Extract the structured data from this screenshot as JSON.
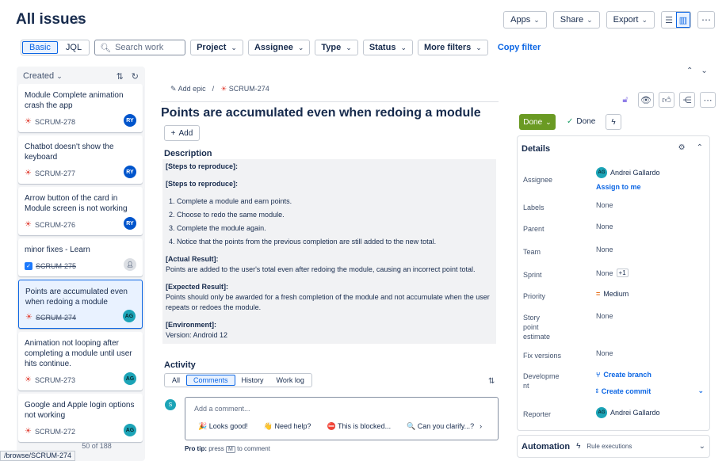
{
  "header": {
    "title": "All issues",
    "apps": "Apps",
    "share": "Share",
    "export": "Export"
  },
  "filters": {
    "basic": "Basic",
    "jql": "JQL",
    "search_placeholder": "Search work",
    "project": "Project",
    "assignee": "Assignee",
    "type": "Type",
    "status": "Status",
    "more": "More filters",
    "copy": "Copy filter"
  },
  "list": {
    "sort_label": "Created",
    "footer": "50 of 188",
    "url_tip": "/browse/SCRUM-274",
    "cards": [
      {
        "title": "Module Complete animation crash the app",
        "key": "SCRUM-278",
        "avatar": "RY"
      },
      {
        "title": "Chatbot doesn't show the keyboard",
        "key": "SCRUM-277",
        "avatar": "RY"
      },
      {
        "title": "Arrow button of the card in Module screen is not working",
        "key": "SCRUM-276",
        "avatar": "RY"
      },
      {
        "title": "minor fixes - Learn",
        "key": "SCRUM-275",
        "avatar": ""
      },
      {
        "title": "Points are accumulated even when redoing a module",
        "key": "SCRUM-274",
        "avatar": "AG"
      },
      {
        "title": "Animation not looping after completing a module until user hits continue.",
        "key": "SCRUM-273",
        "avatar": "AG"
      },
      {
        "title": "Google and Apple login options not working",
        "key": "SCRUM-272",
        "avatar": "AG"
      }
    ]
  },
  "issue": {
    "add_epic": "Add epic",
    "key": "SCRUM-274",
    "title": "Points are accumulated even when redoing a module",
    "add": "Add",
    "description_heading": "Description",
    "steps_1": "[Steps to reproduce]:",
    "steps_2": "[Steps to reproduce]:",
    "step_items": [
      "Complete a module and earn points.",
      "Choose to redo the same module.",
      "Complete the module again.",
      "Notice that the points from the previous completion are still added to the new total."
    ],
    "actual_h": "[Actual Result]:",
    "actual": "Points are added to the user's total even after redoing the module, causing an incorrect point total.",
    "expected_h": "[Expected Result]:",
    "expected": "Points should only be awarded for a fresh completion of the module and not accumulate when the user repeats or redoes the module.",
    "env_h": "[Environment]:",
    "env": "Version: Android 12"
  },
  "activity": {
    "heading": "Activity",
    "tabs": [
      "All",
      "Comments",
      "History",
      "Work log"
    ],
    "avatar": "S",
    "placeholder": "Add a comment...",
    "quick": [
      "🎉 Looks good!",
      "👋 Need help?",
      "⛔ This is blocked...",
      "🔍 Can you clarify...?"
    ],
    "pro_tip_label": "Pro tip:",
    "pro_tip_press": "press",
    "pro_tip_key": "M",
    "pro_tip_rest": "to comment"
  },
  "sidebar": {
    "status": "Done",
    "state": "Done",
    "details_heading": "Details",
    "fields": {
      "assignee_label": "Assignee",
      "assignee": "Andrei Gallardo",
      "assignee_initials": "AG",
      "assign_me": "Assign to me",
      "labels_label": "Labels",
      "labels": "None",
      "parent_label": "Parent",
      "parent": "None",
      "team_label": "Team",
      "team": "None",
      "sprint_label": "Sprint",
      "sprint": "None",
      "sprint_extra": "+1",
      "priority_label": "Priority",
      "priority": "Medium",
      "story_label_1": "Story",
      "story_label_2": "point",
      "story_label_3": "estimate",
      "story": "None",
      "fix_label": "Fix versions",
      "fix": "None",
      "dev_label_1": "Developme",
      "dev_label_2": "nt",
      "create_branch": "Create branch",
      "create_commit": "Create commit",
      "reporter_label": "Reporter",
      "reporter": "Andrei Gallardo",
      "reporter_initials": "AG"
    },
    "automation": "Automation",
    "rule_exec": "Rule executions"
  },
  "colors": {
    "accent": "#0c66e4",
    "done_green": "#6a9a23",
    "bug_red": "#e2483d"
  }
}
